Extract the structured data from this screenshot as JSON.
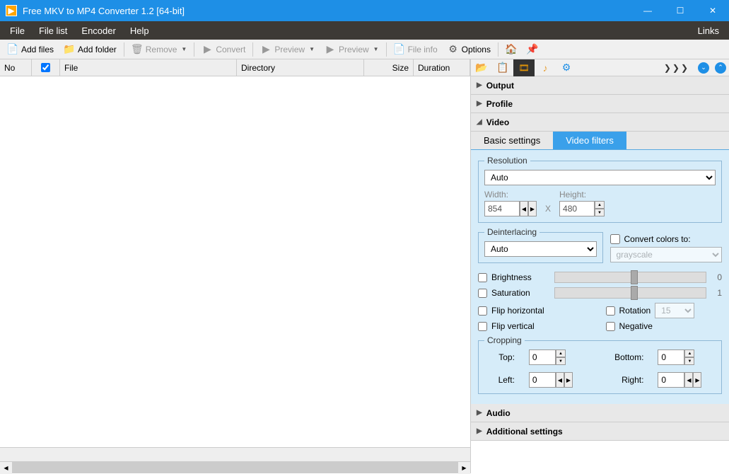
{
  "window": {
    "title": "Free MKV to MP4 Converter 1.2  [64-bit]"
  },
  "menu": {
    "file": "File",
    "filelist": "File list",
    "encoder": "Encoder",
    "help": "Help",
    "links": "Links"
  },
  "toolbar": {
    "add_files": "Add files",
    "add_folder": "Add folder",
    "remove": "Remove",
    "convert": "Convert",
    "preview1": "Preview",
    "preview2": "Preview",
    "file_info": "File info",
    "options": "Options"
  },
  "table": {
    "no": "No",
    "file": "File",
    "directory": "Directory",
    "size": "Size",
    "duration": "Duration"
  },
  "right_tabs": {
    "chevrons": "❯❯❯"
  },
  "sections": {
    "output": "Output",
    "profile": "Profile",
    "video": "Video",
    "audio": "Audio",
    "additional": "Additional settings"
  },
  "subtabs": {
    "basic": "Basic settings",
    "filters": "Video filters"
  },
  "video": {
    "resolution_label": "Resolution",
    "resolution_value": "Auto",
    "width_label": "Width:",
    "width_value": "854",
    "height_label": "Height:",
    "height_value": "480",
    "deinterlacing_label": "Deinterlacing",
    "deinterlacing_value": "Auto",
    "convert_colors_label": "Convert colors to:",
    "convert_colors_value": "grayscale",
    "brightness_label": "Brightness",
    "brightness_value": "0",
    "saturation_label": "Saturation",
    "saturation_value": "1",
    "flip_h": "Flip horizontal",
    "flip_v": "Flip vertical",
    "rotation_label": "Rotation",
    "rotation_value": "15",
    "negative_label": "Negative",
    "cropping_label": "Cropping",
    "top": "Top:",
    "bottom": "Bottom:",
    "left": "Left:",
    "right": "Right:",
    "crop_top": "0",
    "crop_bottom": "0",
    "crop_left": "0",
    "crop_right": "0"
  }
}
